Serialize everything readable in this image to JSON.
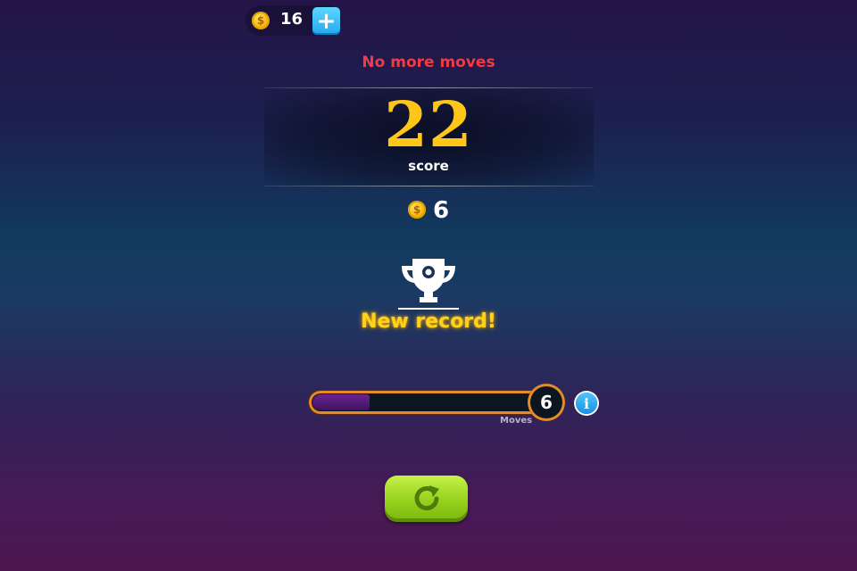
{
  "header": {
    "coin_balance": "16",
    "add_coins_label": "+"
  },
  "result": {
    "status": "No more moves",
    "score": "22",
    "score_label": "score",
    "coins_earned": "6"
  },
  "record": {
    "label": "New record!"
  },
  "moves": {
    "count": "6",
    "label": "Moves",
    "progress_fraction": 0.25,
    "info_label": "i"
  },
  "icons": {
    "coin": "coin-icon",
    "trophy": "trophy-icon",
    "replay": "replay-icon",
    "info": "info-icon",
    "plus": "plus-icon"
  },
  "colors": {
    "status_red": "#f03a45",
    "score_gold": "#ffc61a",
    "record_yellow": "#ffd21a",
    "bar_border": "#e68a25",
    "bar_fill": "#5a1c80",
    "replay_green": "#95d11c",
    "info_blue": "#1a8fe0"
  }
}
